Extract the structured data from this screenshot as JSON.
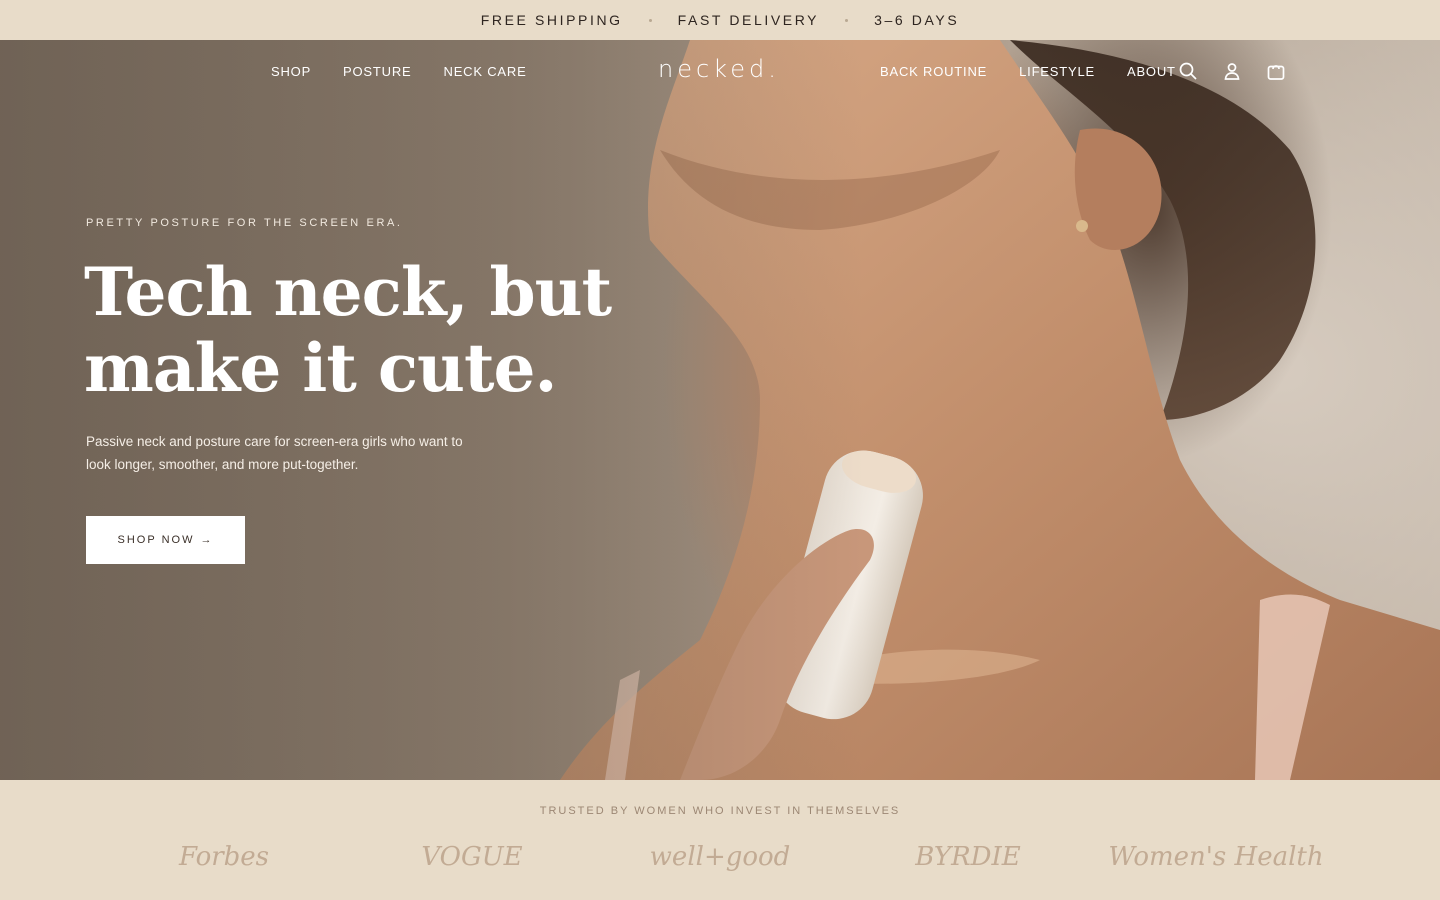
{
  "announcement": {
    "items": [
      "FREE SHIPPING",
      "FAST DELIVERY",
      "3–6 DAYS"
    ]
  },
  "nav": {
    "left": [
      "SHOP",
      "POSTURE",
      "NECK CARE"
    ],
    "logo": "necked.",
    "right": [
      "BACK ROUTINE",
      "LIFESTYLE",
      "ABOUT"
    ],
    "icons": [
      "search-icon",
      "account-icon",
      "cart-icon"
    ]
  },
  "hero": {
    "eyebrow": "PRETTY POSTURE FOR THE SCREEN ERA.",
    "headline_line1": "Tech neck, but",
    "headline_line2": "make it cute.",
    "subcopy": "Passive neck and posture care for screen-era girls who want to look longer, smoother, and more put-together.",
    "cta_label": "SHOP NOW",
    "cta_arrow": "→"
  },
  "press": {
    "label": "TRUSTED BY WOMEN WHO INVEST IN THEMSELVES",
    "logos": [
      "Forbes",
      "VOGUE",
      "well+good",
      "BYRDIE",
      "Women's Health"
    ]
  },
  "colors": {
    "announcement_bg": "#e8dcc9",
    "cta_bg": "#ffffff",
    "press_text": "#c2ab94"
  }
}
